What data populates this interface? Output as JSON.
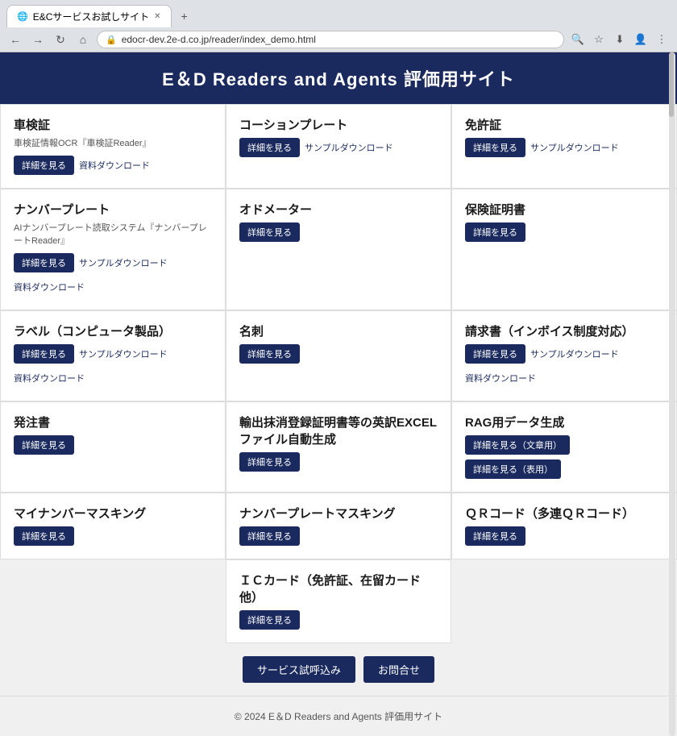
{
  "browser": {
    "tab_title": "E&Cサービスお試しサイト",
    "url": "edocr-dev.2e-d.co.jp/reader/index_demo.html",
    "new_tab_label": "+",
    "back_label": "←",
    "forward_label": "→",
    "refresh_label": "↻",
    "home_label": "⌂"
  },
  "page": {
    "title": "E＆D Readers and Agents 評価用サイト",
    "footer": "© 2024 E＆D Readers and Agents 評価用サイト"
  },
  "cards": [
    {
      "id": "shaken",
      "title": "車検証",
      "subtitle": "車検証情報OCR『車検証Reader』",
      "actions": [
        {
          "type": "btn",
          "label": "詳細を見る"
        },
        {
          "type": "link",
          "label": "資料ダウンロード"
        }
      ]
    },
    {
      "id": "cushion",
      "title": "コーションプレート",
      "subtitle": "",
      "actions": [
        {
          "type": "btn",
          "label": "詳細を見る"
        },
        {
          "type": "link",
          "label": "サンプルダウンロード"
        }
      ]
    },
    {
      "id": "menkyo",
      "title": "免許証",
      "subtitle": "",
      "actions": [
        {
          "type": "btn",
          "label": "詳細を見る"
        },
        {
          "type": "link",
          "label": "サンプルダウンロード"
        }
      ]
    },
    {
      "id": "number_plate",
      "title": "ナンバープレート",
      "subtitle": "AIナンバープレート読取システム『ナンバープレートReader』",
      "actions": [
        {
          "type": "btn",
          "label": "詳細を見る"
        },
        {
          "type": "link",
          "label": "サンプルダウンロード"
        },
        {
          "type": "link",
          "label": "資料ダウンロード"
        }
      ]
    },
    {
      "id": "odometer",
      "title": "オドメーター",
      "subtitle": "",
      "actions": [
        {
          "type": "btn",
          "label": "詳細を見る"
        }
      ]
    },
    {
      "id": "hoken",
      "title": "保険証明書",
      "subtitle": "",
      "actions": [
        {
          "type": "btn",
          "label": "詳細を見る"
        }
      ]
    },
    {
      "id": "label",
      "title": "ラベル（コンピュータ製品）",
      "subtitle": "",
      "actions": [
        {
          "type": "btn",
          "label": "詳細を見る"
        },
        {
          "type": "link",
          "label": "サンプルダウンロード"
        },
        {
          "type": "link",
          "label": "資料ダウンロード"
        }
      ]
    },
    {
      "id": "meishi",
      "title": "名刺",
      "subtitle": "",
      "actions": [
        {
          "type": "btn",
          "label": "詳細を見る"
        }
      ]
    },
    {
      "id": "seikyusho",
      "title": "請求書（インボイス制度対応）",
      "subtitle": "",
      "actions": [
        {
          "type": "btn",
          "label": "詳細を見る"
        },
        {
          "type": "link",
          "label": "サンプルダウンロード"
        },
        {
          "type": "link",
          "label": "資料ダウンロード"
        }
      ]
    },
    {
      "id": "hanchusho",
      "title": "発注書",
      "subtitle": "",
      "actions": [
        {
          "type": "btn",
          "label": "詳細を見る"
        }
      ]
    },
    {
      "id": "eiyaku",
      "title": "輸出抹消登録証明書等の英訳EXCELファイル自動生成",
      "subtitle": "",
      "actions": [
        {
          "type": "btn",
          "label": "詳細を見る"
        }
      ]
    },
    {
      "id": "rag",
      "title": "RAG用データ生成",
      "subtitle": "",
      "actions": [
        {
          "type": "btn",
          "label": "詳細を見る（文章用）"
        },
        {
          "type": "btn",
          "label": "詳細を見る（表用）"
        }
      ]
    },
    {
      "id": "my_number_masking",
      "title": "マイナンバーマスキング",
      "subtitle": "",
      "actions": [
        {
          "type": "btn",
          "label": "詳細を見る"
        }
      ]
    },
    {
      "id": "plate_masking",
      "title": "ナンバープレートマスキング",
      "subtitle": "",
      "actions": [
        {
          "type": "btn",
          "label": "詳細を見る"
        }
      ]
    },
    {
      "id": "qr",
      "title": "ＱＲコード（多連ＱＲコード）",
      "subtitle": "",
      "actions": [
        {
          "type": "btn",
          "label": "詳細を見る"
        }
      ]
    },
    {
      "id": "ic_card",
      "title": "ＩＣカード（免許証、在留カード他）",
      "subtitle": "",
      "actions": [
        {
          "type": "btn",
          "label": "詳細を見る"
        }
      ]
    }
  ],
  "bottom_actions": [
    {
      "id": "trial",
      "label": "サービス試呼込み"
    },
    {
      "id": "contact",
      "label": "お問合せ"
    }
  ]
}
